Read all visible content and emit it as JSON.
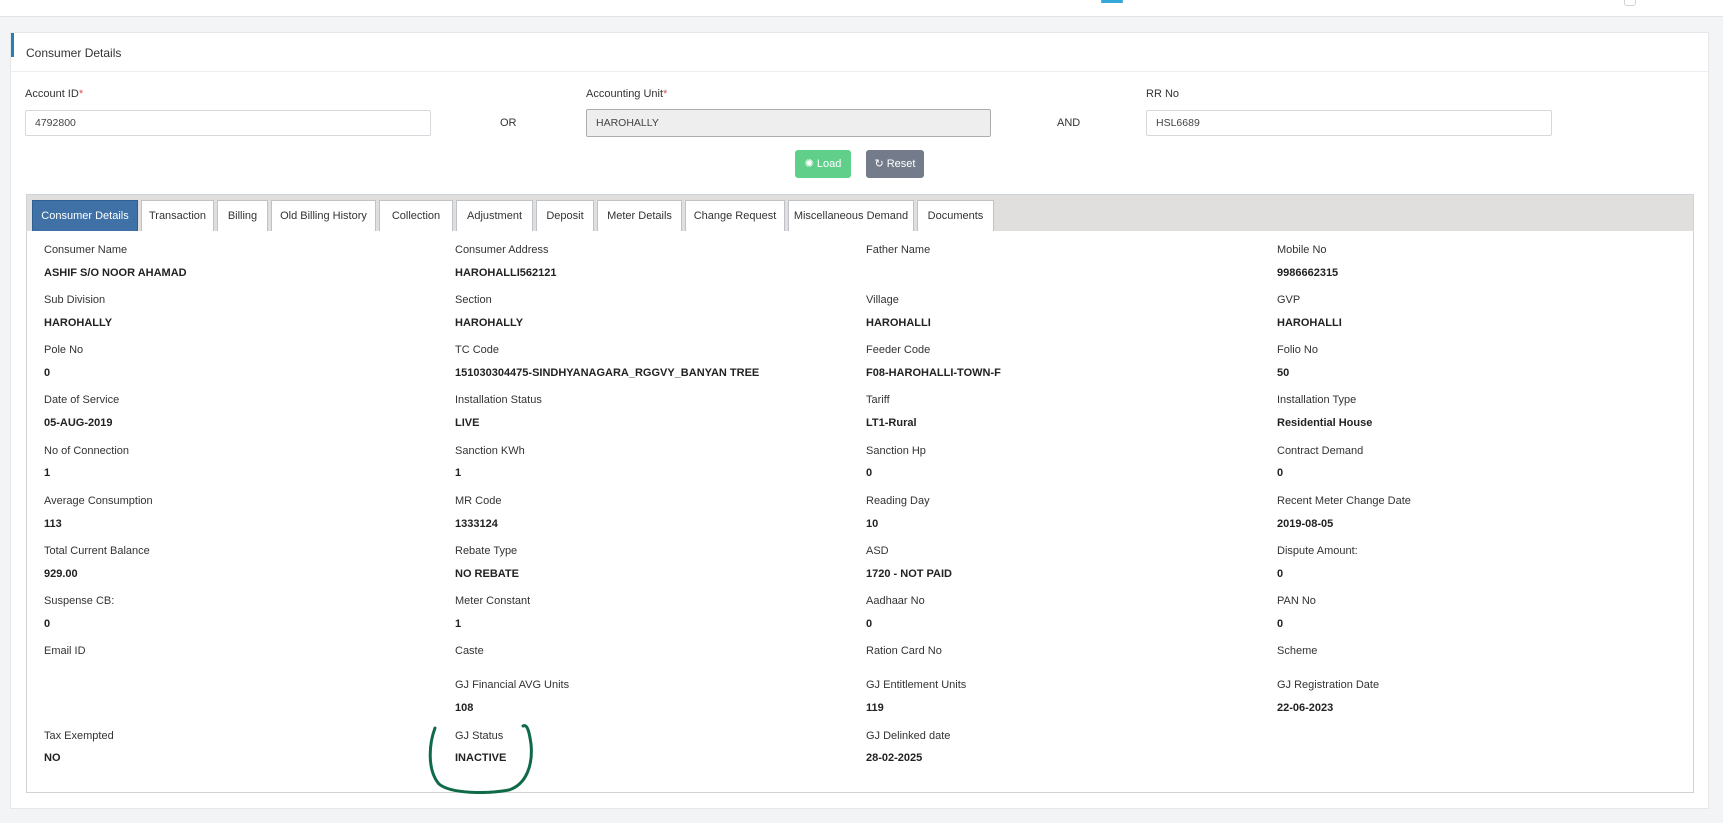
{
  "panel": {
    "title": "Consumer Details"
  },
  "form": {
    "account_id": {
      "label": "Account ID",
      "required_mark": "*",
      "value": "4792800"
    },
    "or_label": "OR",
    "accounting_unit": {
      "label": "Accounting Unit",
      "required_mark": "*",
      "value": "HAROHALLY"
    },
    "and_label": "AND",
    "rr_no": {
      "label": "RR No",
      "value": "HSL6689"
    }
  },
  "buttons": {
    "load": {
      "label": "Load",
      "icon": "spinner-icon"
    },
    "reset": {
      "label": "Reset",
      "icon": "refresh-icon"
    }
  },
  "colors": {
    "active_tab": "#3f71a6",
    "load": "#5fcf8a",
    "reset": "#747c8c",
    "annotation": "#0f6b47"
  },
  "tabs": [
    {
      "label": "Consumer Details"
    },
    {
      "label": "Transaction"
    },
    {
      "label": "Billing"
    },
    {
      "label": "Old Billing History"
    },
    {
      "label": "Collection"
    },
    {
      "label": "Adjustment"
    },
    {
      "label": "Deposit"
    },
    {
      "label": "Meter Details"
    },
    {
      "label": "Change Request"
    },
    {
      "label": "Miscellaneous Demand"
    },
    {
      "label": "Documents"
    }
  ],
  "details": [
    {
      "label": "Consumer Name",
      "value": "ASHIF S/O NOOR AHAMAD"
    },
    {
      "label": "Consumer Address",
      "value": "HAROHALLI562121"
    },
    {
      "label": "Father Name",
      "value": ""
    },
    {
      "label": "Mobile No",
      "value": "9986662315"
    },
    {
      "label": "Sub Division",
      "value": "HAROHALLY"
    },
    {
      "label": "Section",
      "value": "HAROHALLY"
    },
    {
      "label": "Village",
      "value": "HAROHALLI"
    },
    {
      "label": "GVP",
      "value": "HAROHALLI"
    },
    {
      "label": "Pole No",
      "value": "0"
    },
    {
      "label": "TC Code",
      "value": "151030304475-SINDHYANAGARA_RGGVY_BANYAN TREE"
    },
    {
      "label": "Feeder Code",
      "value": "F08-HAROHALLI-TOWN-F"
    },
    {
      "label": "Folio No",
      "value": "50"
    },
    {
      "label": "Date of Service",
      "value": "05-AUG-2019"
    },
    {
      "label": "Installation Status",
      "value": "LIVE"
    },
    {
      "label": "Tariff",
      "value": "LT1-Rural"
    },
    {
      "label": "Installation Type",
      "value": "Residential House"
    },
    {
      "label": "No of Connection",
      "value": "1"
    },
    {
      "label": "Sanction KWh",
      "value": "1"
    },
    {
      "label": "Sanction Hp",
      "value": "0"
    },
    {
      "label": "Contract Demand",
      "value": "0"
    },
    {
      "label": "Average Consumption",
      "value": "113"
    },
    {
      "label": "MR Code",
      "value": "1333124"
    },
    {
      "label": "Reading Day",
      "value": "10"
    },
    {
      "label": "Recent Meter Change Date",
      "value": "2019-08-05"
    },
    {
      "label": "Total Current Balance",
      "value": "929.00"
    },
    {
      "label": "Rebate Type",
      "value": "NO REBATE"
    },
    {
      "label": "ASD",
      "value": "1720 - NOT PAID"
    },
    {
      "label": "Dispute Amount:",
      "value": "0"
    },
    {
      "label": "Suspense CB:",
      "value": "0"
    },
    {
      "label": "Meter Constant",
      "value": "1"
    },
    {
      "label": "Aadhaar No",
      "value": "0"
    },
    {
      "label": "PAN No",
      "value": "0"
    },
    {
      "label": "Email ID",
      "value": ""
    },
    {
      "label": "Caste",
      "value": ""
    },
    {
      "label": "Ration Card No",
      "value": ""
    },
    {
      "label": "Scheme",
      "value": ""
    },
    {
      "label": "GJ Financial AVG Units",
      "value": "108"
    },
    {
      "label": "GJ Entitlement Units",
      "value": "119"
    },
    {
      "label": "GJ Registration Date",
      "value": "22-06-2023"
    },
    {
      "label": "Tax Exempted",
      "value": "NO"
    },
    {
      "label": "GJ Status",
      "value": "INACTIVE"
    },
    {
      "label": "GJ Delinked date",
      "value": "28-02-2025"
    }
  ]
}
